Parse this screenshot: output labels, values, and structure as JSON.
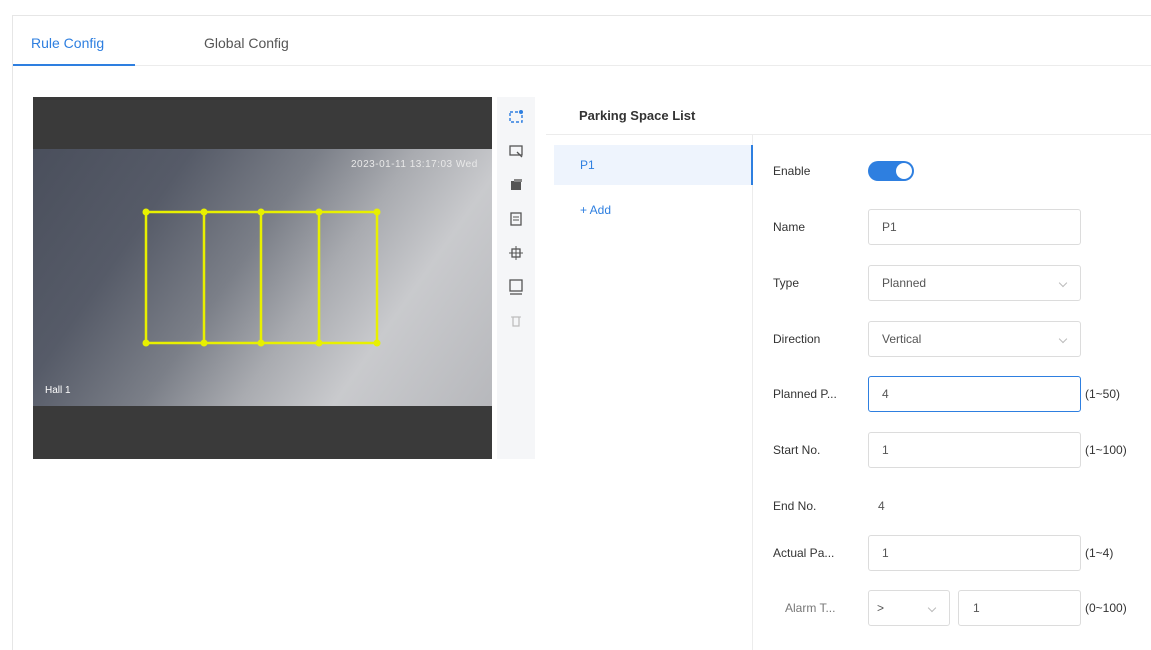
{
  "tabs": [
    {
      "label": "Rule Config",
      "active": true
    },
    {
      "label": "Global Config",
      "active": false
    }
  ],
  "video": {
    "osd_time": "2023-01-11 13:17:03 Wed",
    "osd_name": "Hall 1"
  },
  "toolbar": {
    "icons": [
      "draw-area-icon",
      "draw-rule-icon",
      "clear-icon",
      "copy-icon",
      "adjust-area-icon",
      "fullscreen-area-icon",
      "delete-icon"
    ]
  },
  "parking_list": {
    "title": "Parking Space List",
    "items": [
      {
        "label": "P1",
        "selected": true
      }
    ],
    "add_label": "+  Add"
  },
  "form": {
    "enable": {
      "label": "Enable",
      "on": true
    },
    "name": {
      "label": "Name",
      "value": "P1"
    },
    "type": {
      "label": "Type",
      "value": "Planned"
    },
    "direction": {
      "label": "Direction",
      "value": "Vertical"
    },
    "planned": {
      "label": "Planned P...",
      "value": "4",
      "range": "(1~50)"
    },
    "start_no": {
      "label": "Start No.",
      "value": "1",
      "range": "(1~100)"
    },
    "end_no": {
      "label": "End No.",
      "value": "4"
    },
    "actual": {
      "label": "Actual Pa...",
      "value": "1",
      "range": "(1~4)"
    },
    "alarm": {
      "label": "Alarm T...",
      "op_value": ">",
      "value": "1",
      "range": "(0~100)"
    }
  },
  "colors": {
    "accent": "#2e7fe0",
    "rule_line": "#e8f000"
  }
}
